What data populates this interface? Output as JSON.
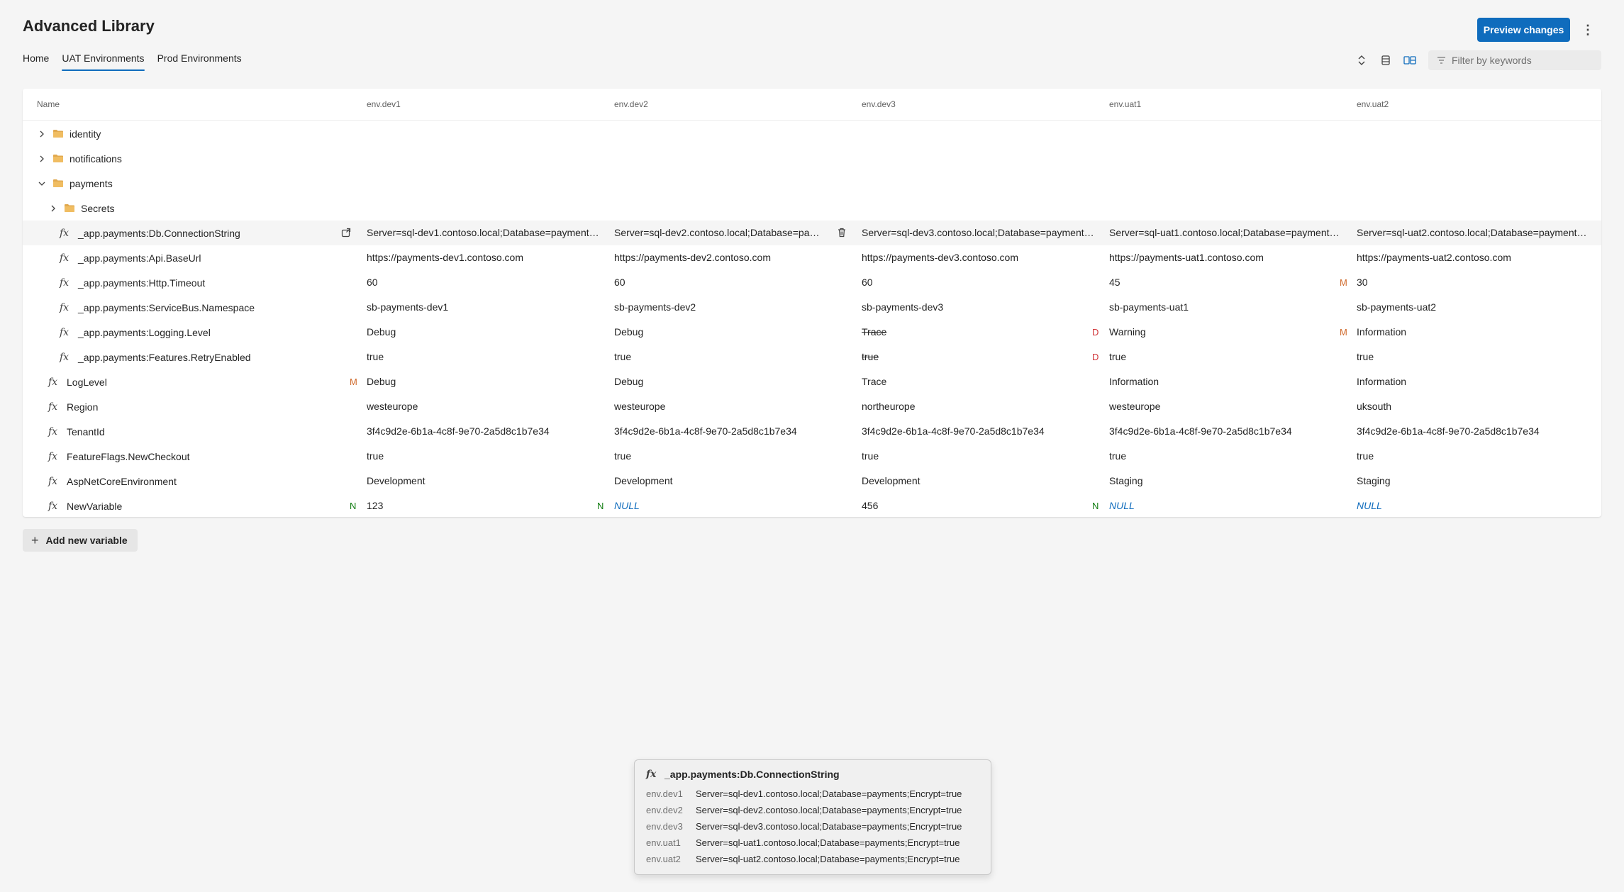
{
  "header": {
    "title": "Advanced Library",
    "preview_label": "Preview changes",
    "more_icon": "more-vertical-icon"
  },
  "tabs": [
    {
      "label": "Home",
      "active": false
    },
    {
      "label": "UAT Environments",
      "active": true
    },
    {
      "label": "Prod Environments",
      "active": false
    }
  ],
  "toolbar": {
    "filter_placeholder": "Filter by keywords",
    "icons": [
      "expand-collapse-icon",
      "compact-view-icon",
      "split-view-icon",
      "filter-icon"
    ],
    "accent": "#0f6cbd"
  },
  "table": {
    "columns": [
      "Name",
      "env.dev1",
      "env.dev2",
      "env.dev3",
      "env.uat1",
      "env.uat2"
    ],
    "rows": [
      {
        "type": "folder",
        "name": "identity",
        "expanded": false,
        "level": 0,
        "values": [
          "",
          "",
          "",
          "",
          ""
        ]
      },
      {
        "type": "folder",
        "name": "notifications",
        "expanded": false,
        "level": 0,
        "values": [
          "",
          "",
          "",
          "",
          ""
        ]
      },
      {
        "type": "folder",
        "name": "payments",
        "expanded": true,
        "level": 0,
        "values": [
          "",
          "",
          "",
          "",
          ""
        ]
      },
      {
        "type": "folder",
        "name": "Secrets",
        "expanded": false,
        "level": 1,
        "values": [
          "",
          "",
          "",
          "",
          ""
        ]
      },
      {
        "type": "var",
        "name": "_app.payments:Db.ConnectionString",
        "level": 2,
        "highlighted": true,
        "values": [
          "Server=sql-dev1.contoso.local;Database=payments;Encrypt=true",
          "Server=sql-dev2.contoso.local;Database=payments;Encrypt=true",
          "Server=sql-dev3.contoso.local;Database=payments;Encrypt=true",
          "Server=sql-uat1.contoso.local;Database=payments;Encrypt=true",
          "Server=sql-uat2.contoso.local;Database=payments;Encrypt=true"
        ],
        "badges": [
          "",
          "",
          "",
          "",
          ""
        ]
      },
      {
        "type": "var",
        "name": "_app.payments:Api.BaseUrl",
        "level": 2,
        "values": [
          "https://payments-dev1.contoso.com",
          "https://payments-dev2.contoso.com",
          "https://payments-dev3.contoso.com",
          "https://payments-uat1.contoso.com",
          "https://payments-uat2.contoso.com"
        ],
        "badges": [
          "",
          "",
          "",
          "",
          ""
        ]
      },
      {
        "type": "var",
        "name": "_app.payments:Http.Timeout",
        "level": 2,
        "values": [
          "60",
          "60",
          "60",
          "45",
          "30"
        ],
        "badges": [
          "",
          "",
          "",
          "M",
          ""
        ]
      },
      {
        "type": "var",
        "name": "_app.payments:ServiceBus.Namespace",
        "level": 2,
        "values": [
          "sb-payments-dev1",
          "sb-payments-dev2",
          "sb-payments-dev3",
          "sb-payments-uat1",
          "sb-payments-uat2"
        ],
        "badges": [
          "",
          "",
          "",
          "",
          ""
        ]
      },
      {
        "type": "var",
        "name": "_app.payments:Logging.Level",
        "level": 2,
        "values": [
          "Debug",
          "Debug",
          "Trace",
          "Warning",
          "Information"
        ],
        "badges": [
          "",
          "",
          "D",
          "M",
          ""
        ],
        "strike": [
          false,
          false,
          true,
          false,
          false
        ]
      },
      {
        "type": "var",
        "name": "_app.payments:Features.RetryEnabled",
        "level": 2,
        "values": [
          "true",
          "true",
          "true",
          "true",
          "true"
        ],
        "badges": [
          "",
          "",
          "D",
          "",
          ""
        ],
        "strike": [
          false,
          false,
          true,
          false,
          false
        ]
      },
      {
        "type": "var",
        "name": "LogLevel",
        "level": 1,
        "values": [
          "Debug",
          "Debug",
          "Trace",
          "Information",
          "Information"
        ],
        "badges": [
          "M",
          "",
          "",
          "",
          ""
        ]
      },
      {
        "type": "var",
        "name": "Region",
        "level": 1,
        "values": [
          "westeurope",
          "westeurope",
          "northeurope",
          "westeurope",
          "uksouth"
        ],
        "badges": [
          "",
          "",
          "",
          "",
          ""
        ]
      },
      {
        "type": "var",
        "name": "TenantId",
        "level": 1,
        "values": [
          "3f4c9d2e-6b1a-4c8f-9e70-2a5d8c1b7e34",
          "3f4c9d2e-6b1a-4c8f-9e70-2a5d8c1b7e34",
          "3f4c9d2e-6b1a-4c8f-9e70-2a5d8c1b7e34",
          "3f4c9d2e-6b1a-4c8f-9e70-2a5d8c1b7e34",
          "3f4c9d2e-6b1a-4c8f-9e70-2a5d8c1b7e34"
        ],
        "badges": [
          "",
          "",
          "",
          "",
          ""
        ]
      },
      {
        "type": "var",
        "name": "FeatureFlags.NewCheckout",
        "level": 1,
        "values": [
          "true",
          "true",
          "true",
          "true",
          "true"
        ],
        "badges": [
          "",
          "",
          "",
          "",
          ""
        ]
      },
      {
        "type": "var",
        "name": "AspNetCoreEnvironment",
        "level": 1,
        "values": [
          "Development",
          "Development",
          "Development",
          "Staging",
          "Staging"
        ],
        "badges": [
          "",
          "",
          "",
          "",
          ""
        ]
      },
      {
        "type": "var",
        "name": "NewVariable",
        "level": 1,
        "values": [
          "123",
          "NULL",
          "456",
          "NULL",
          "NULL"
        ],
        "badges": [
          "N",
          "N",
          "",
          "N",
          ""
        ],
        "nulls": [
          false,
          true,
          false,
          true,
          true
        ]
      }
    ]
  },
  "add_button": {
    "label": "Add new variable"
  },
  "tooltip": {
    "title": "_app.payments:Db.ConnectionString",
    "rows": [
      {
        "env": "env.dev1",
        "value": "Server=sql-dev1.contoso.local;Database=payments;Encrypt=true"
      },
      {
        "env": "env.dev2",
        "value": "Server=sql-dev2.contoso.local;Database=payments;Encrypt=true"
      },
      {
        "env": "env.dev3",
        "value": "Server=sql-dev3.contoso.local;Database=payments;Encrypt=true"
      },
      {
        "env": "env.uat1",
        "value": "Server=sql-uat1.contoso.local;Database=payments;Encrypt=true"
      },
      {
        "env": "env.uat2",
        "value": "Server=sql-uat2.contoso.local;Database=payments;Encrypt=true"
      }
    ]
  }
}
